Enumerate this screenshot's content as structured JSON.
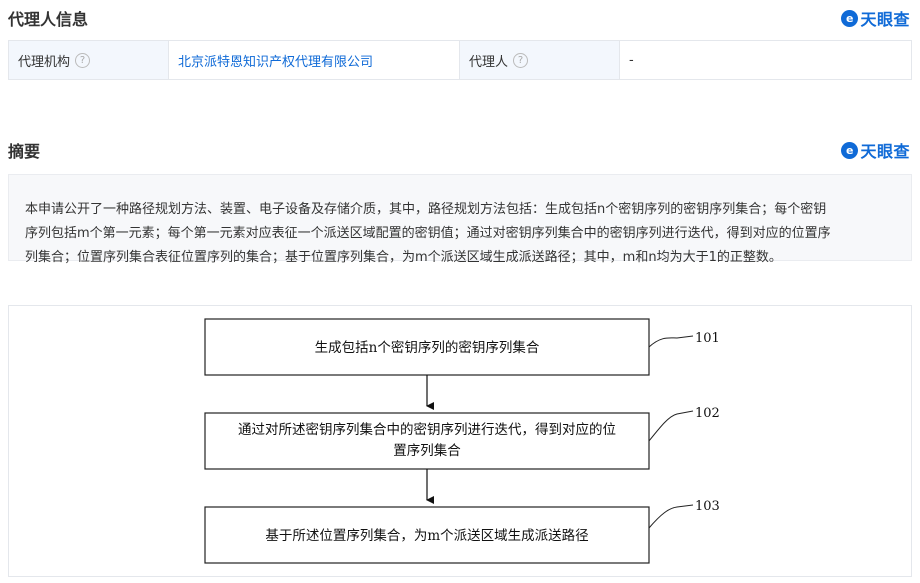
{
  "agent_section": {
    "title": "代理人信息",
    "brand": "天眼查",
    "org_label": "代理机构",
    "org_value": "北京派特恩知识产权代理有限公司",
    "agent_label": "代理人",
    "agent_value": "-"
  },
  "abstract_section": {
    "title": "摘要",
    "brand": "天眼查",
    "lines": [
      "本申请公开了一种路径规划方法、装置、电子设备及存储介质，其中，路径规划方法包括：生成包括n个密钥序列的密钥序列集合；每个密钥",
      "序列包括m个第一元素；每个第一元素对应表征一个派送区域配置的密钥值；通过对密钥序列集合中的密钥序列进行迭代，得到对应的位置序",
      "列集合；位置序列集合表征位置序列的集合；基于位置序列集合，为m个派送区域生成派送路径；其中，m和n均为大于1的正整数。"
    ]
  },
  "flowchart": {
    "steps": [
      {
        "number": "101",
        "lines": [
          "生成包括n个密钥序列的密钥序列集合"
        ]
      },
      {
        "number": "102",
        "lines": [
          "通过对所述密钥序列集合中的密钥序列进行迭代，得到对应的位",
          "置序列集合"
        ]
      },
      {
        "number": "103",
        "lines": [
          "基于所述位置序列集合，为m个派送区域生成派送路径"
        ]
      }
    ]
  },
  "icons": {
    "help": "question-circle-icon",
    "brand_logo": "tianyancha-logo-icon"
  }
}
